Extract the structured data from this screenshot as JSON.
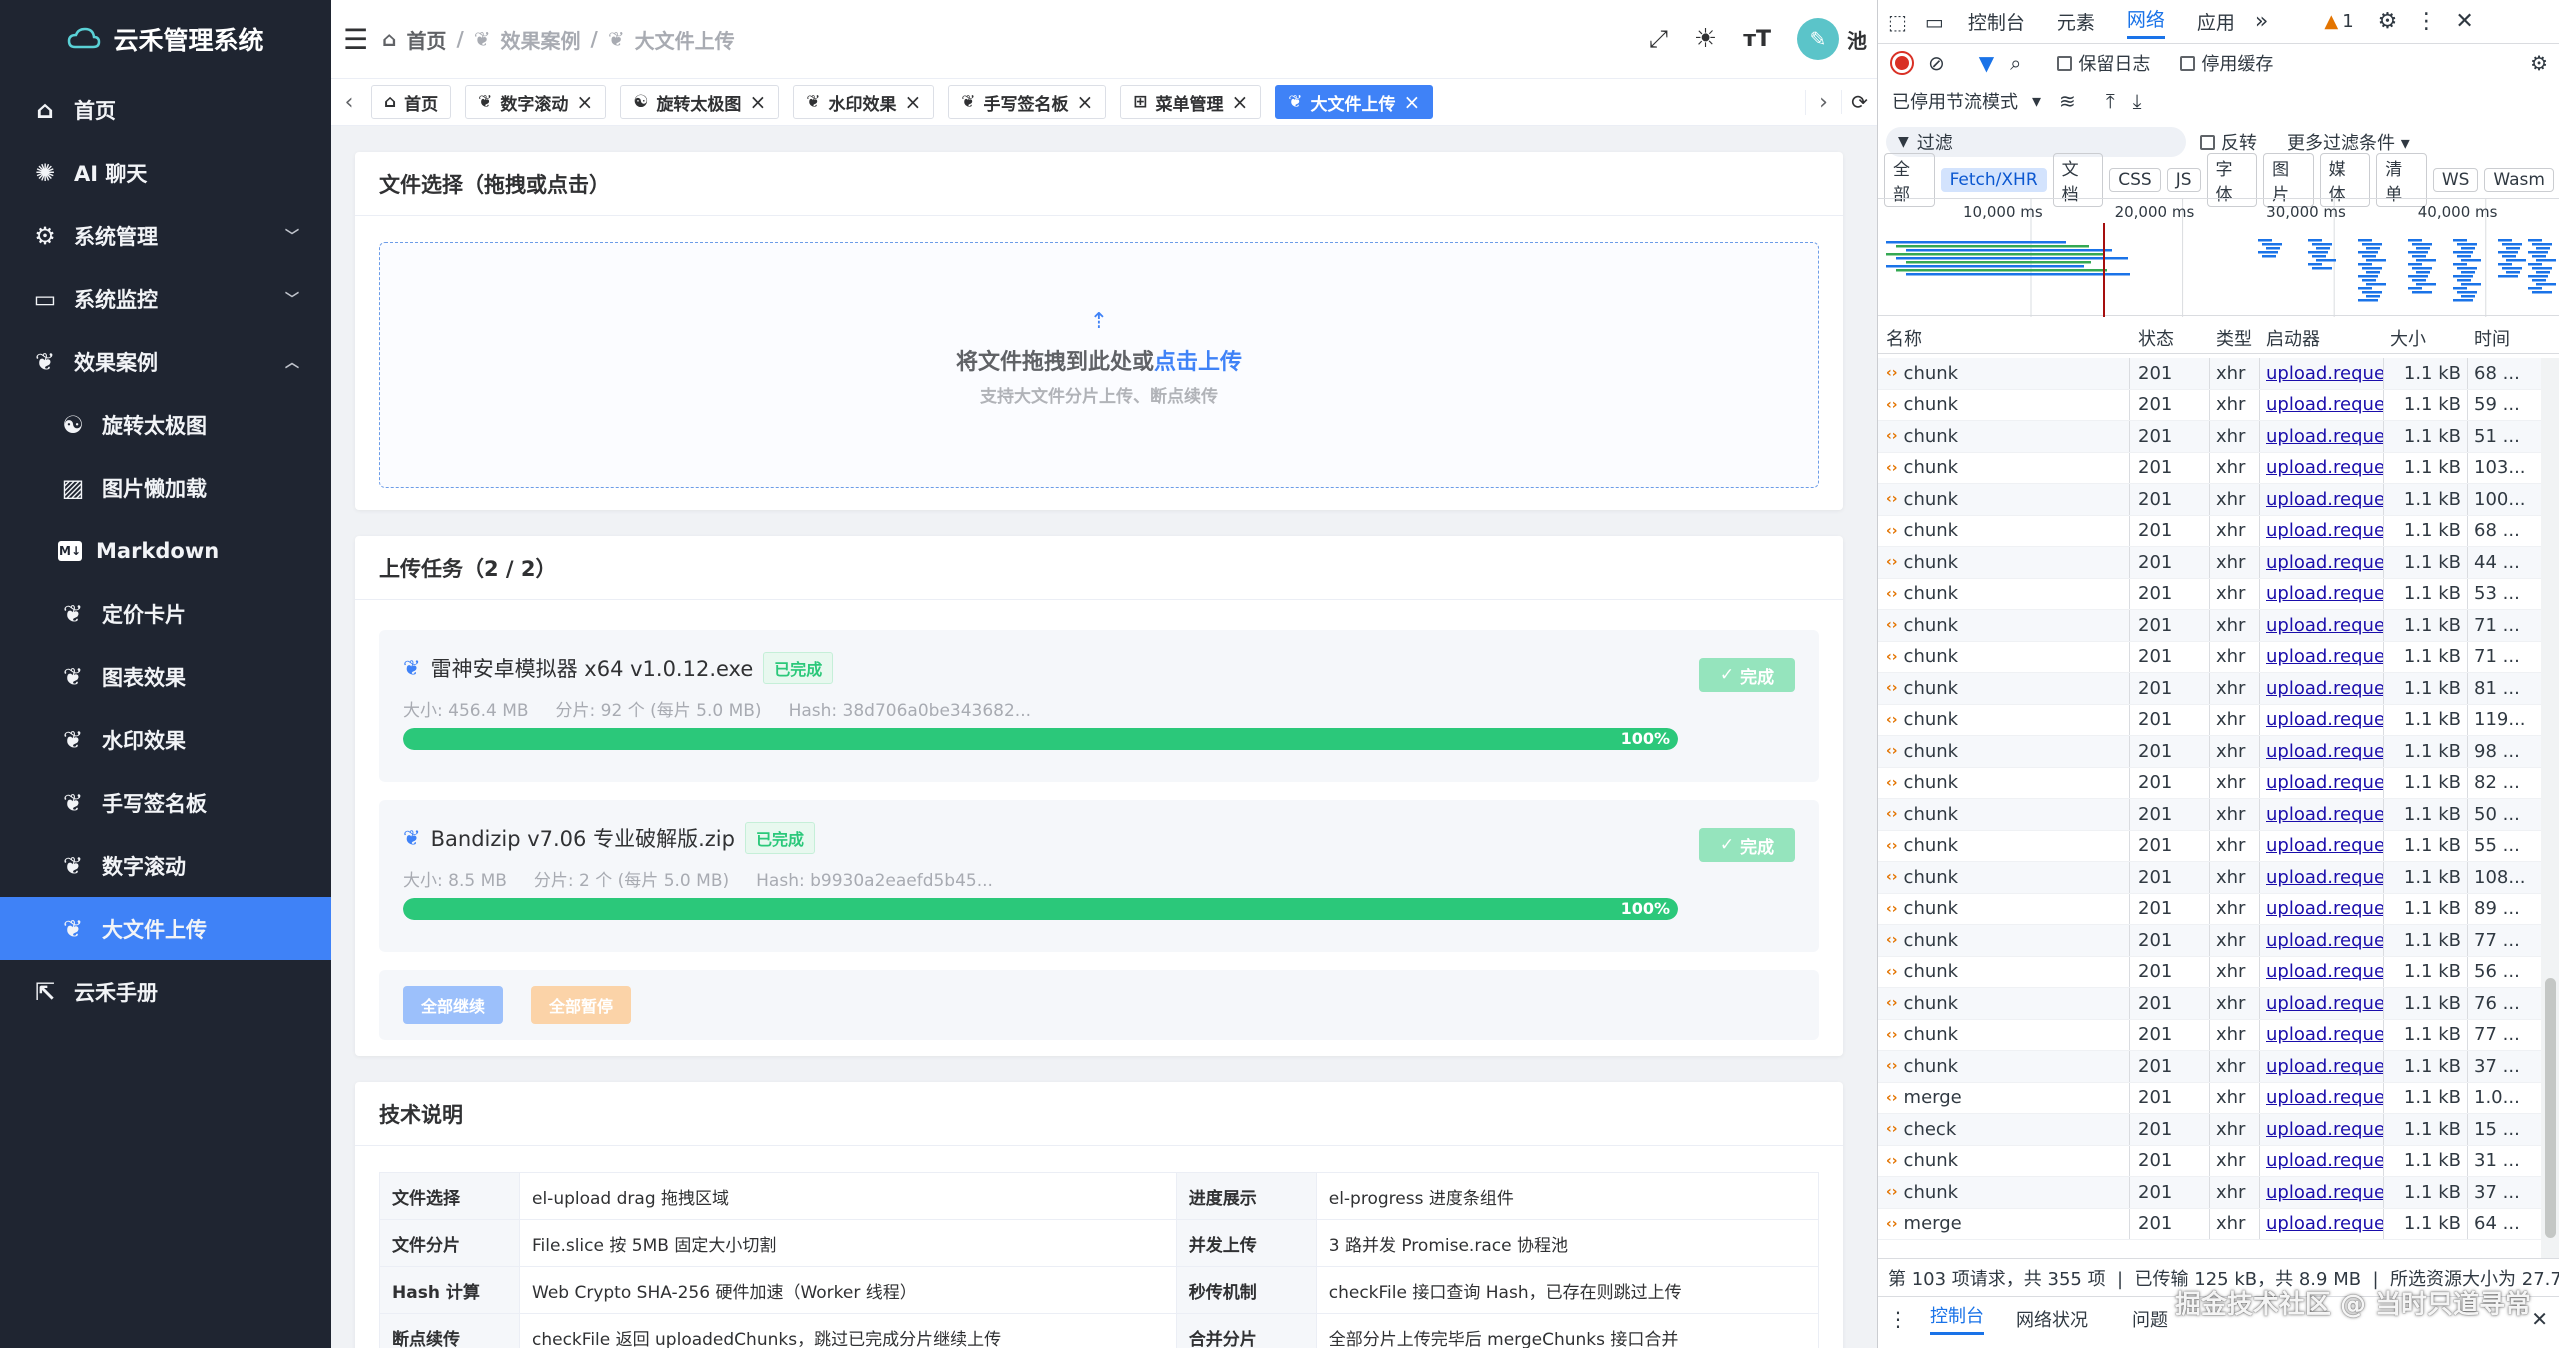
{
  "app": {
    "title": "云禾管理系统"
  },
  "sidebar": {
    "items": [
      {
        "label": "首页",
        "icon": "home-icon",
        "sub": false,
        "arrow": ""
      },
      {
        "label": "AI 聊天",
        "icon": "openai-icon",
        "sub": false,
        "arrow": ""
      },
      {
        "label": "系统管理",
        "icon": "gear-icon",
        "sub": false,
        "arrow": "down"
      },
      {
        "label": "系统监控",
        "icon": "monitor-icon",
        "sub": false,
        "arrow": "down"
      },
      {
        "label": "效果案例",
        "icon": "leaf-icon",
        "sub": false,
        "arrow": "up"
      },
      {
        "label": "旋转太极图",
        "icon": "taiji-icon",
        "sub": true,
        "arrow": ""
      },
      {
        "label": "图片懒加载",
        "icon": "image-icon",
        "sub": true,
        "arrow": ""
      },
      {
        "label": "Markdown",
        "icon": "markdown-icon",
        "sub": true,
        "arrow": ""
      },
      {
        "label": "定价卡片",
        "icon": "leaf-icon",
        "sub": true,
        "arrow": ""
      },
      {
        "label": "图表效果",
        "icon": "leaf-icon",
        "sub": true,
        "arrow": ""
      },
      {
        "label": "水印效果",
        "icon": "leaf-icon",
        "sub": true,
        "arrow": ""
      },
      {
        "label": "手写签名板",
        "icon": "leaf-icon",
        "sub": true,
        "arrow": ""
      },
      {
        "label": "数字滚动",
        "icon": "leaf-icon",
        "sub": true,
        "arrow": ""
      },
      {
        "label": "大文件上传",
        "icon": "leaf-icon",
        "sub": true,
        "arrow": "",
        "active": true
      },
      {
        "label": "云禾手册",
        "icon": "external-link-icon",
        "sub": false,
        "arrow": ""
      }
    ]
  },
  "header": {
    "breadcrumb": [
      "首页",
      "效果案例",
      "大文件上传"
    ],
    "breadcrumb_sep": "/",
    "user_name": "池"
  },
  "tabs": [
    {
      "label": "首页",
      "icon": "home-icon",
      "closable": false
    },
    {
      "label": "数字滚动",
      "icon": "leaf-icon",
      "closable": true
    },
    {
      "label": "旋转太极图",
      "icon": "taiji-icon",
      "closable": true
    },
    {
      "label": "水印效果",
      "icon": "leaf-icon",
      "closable": true
    },
    {
      "label": "手写签名板",
      "icon": "leaf-icon",
      "closable": true
    },
    {
      "label": "菜单管理",
      "icon": "grid-icon",
      "closable": true
    },
    {
      "label": "大文件上传",
      "icon": "leaf-icon",
      "closable": true,
      "active": true
    }
  ],
  "upload_card": {
    "title": "文件选择（拖拽或点击）",
    "drop_text": "将文件拖拽到此处或",
    "drop_link": "点击上传",
    "drop_hint": "支持大文件分片上传、断点续传"
  },
  "tasks_card": {
    "title": "上传任务（2 / 2）",
    "tasks": [
      {
        "name": "雷神安卓模拟器 x64 v1.0.12.exe",
        "status": "已完成",
        "meta": "大小: 456.4 MB     分片: 92 个 (每片 5.0 MB)     Hash: 38d706a0be343682...",
        "progress": 100,
        "progress_label": "100%",
        "button": "完成"
      },
      {
        "name": "Bandizip v7.06 专业破解版.zip",
        "status": "已完成",
        "meta": "大小: 8.5 MB     分片: 2 个 (每片 5.0 MB)     Hash: b9930a2eaefd5b45...",
        "progress": 100,
        "progress_label": "100%",
        "button": "完成"
      }
    ],
    "resume_all": "全部继续",
    "pause_all": "全部暂停"
  },
  "tech_card": {
    "title": "技术说明",
    "rows": [
      {
        "k1": "文件选择",
        "v1": "el-upload drag 拖拽区域",
        "k2": "进度展示",
        "v2": "el-progress 进度条组件"
      },
      {
        "k1": "文件分片",
        "v1": "File.slice 按 5MB 固定大小切割",
        "k2": "并发上传",
        "v2": "3 路并发 Promise.race 协程池"
      },
      {
        "k1": "Hash 计算",
        "v1": "Web Crypto SHA-256 硬件加速（Worker 线程）",
        "k2": "秒传机制",
        "v2": "checkFile 接口查询 Hash，已存在则跳过上传"
      },
      {
        "k1": "断点续传",
        "v1": "checkFile 返回 uploadedChunks，跳过已完成分片继续上传",
        "k2": "合并分片",
        "v2": "全部分片上传完毕后 mergeChunks 接口合并"
      }
    ]
  },
  "devtools": {
    "tabs": [
      "控制台",
      "元素",
      "网络",
      "应用"
    ],
    "active_tab": "网络",
    "warn_count": "1",
    "preserve_log": "保留日志",
    "disable_cache": "停用缓存",
    "throttle": "已停用节流模式",
    "filter_placeholder": "过滤",
    "invert": "反转",
    "more_filters": "更多过滤条件",
    "filter_types": [
      "全部",
      "Fetch/XHR",
      "文档",
      "CSS",
      "JS",
      "字体",
      "图片",
      "媒体",
      "清单",
      "WS",
      "Wasm"
    ],
    "active_filter": "Fetch/XHR",
    "timeline_labels": [
      "10,000 ms",
      "20,000 ms",
      "30,000 ms",
      "40,000 ms"
    ],
    "columns": [
      "名称",
      "状态",
      "类型",
      "启动器",
      "大小",
      "时间"
    ],
    "rows": [
      {
        "name": "chunk",
        "status": "201",
        "type": "xhr",
        "initiator": "upload.reque",
        "size": "1.1 kB",
        "time": "68 ..."
      },
      {
        "name": "chunk",
        "status": "201",
        "type": "xhr",
        "initiator": "upload.reque",
        "size": "1.1 kB",
        "time": "59 ..."
      },
      {
        "name": "chunk",
        "status": "201",
        "type": "xhr",
        "initiator": "upload.reque",
        "size": "1.1 kB",
        "time": "51 ..."
      },
      {
        "name": "chunk",
        "status": "201",
        "type": "xhr",
        "initiator": "upload.reque",
        "size": "1.1 kB",
        "time": "103..."
      },
      {
        "name": "chunk",
        "status": "201",
        "type": "xhr",
        "initiator": "upload.reque",
        "size": "1.1 kB",
        "time": "100..."
      },
      {
        "name": "chunk",
        "status": "201",
        "type": "xhr",
        "initiator": "upload.reque",
        "size": "1.1 kB",
        "time": "68 ..."
      },
      {
        "name": "chunk",
        "status": "201",
        "type": "xhr",
        "initiator": "upload.reque",
        "size": "1.1 kB",
        "time": "44 ..."
      },
      {
        "name": "chunk",
        "status": "201",
        "type": "xhr",
        "initiator": "upload.reque",
        "size": "1.1 kB",
        "time": "53 ..."
      },
      {
        "name": "chunk",
        "status": "201",
        "type": "xhr",
        "initiator": "upload.reque",
        "size": "1.1 kB",
        "time": "71 ..."
      },
      {
        "name": "chunk",
        "status": "201",
        "type": "xhr",
        "initiator": "upload.reque",
        "size": "1.1 kB",
        "time": "71 ..."
      },
      {
        "name": "chunk",
        "status": "201",
        "type": "xhr",
        "initiator": "upload.reque",
        "size": "1.1 kB",
        "time": "81 ..."
      },
      {
        "name": "chunk",
        "status": "201",
        "type": "xhr",
        "initiator": "upload.reque",
        "size": "1.1 kB",
        "time": "119..."
      },
      {
        "name": "chunk",
        "status": "201",
        "type": "xhr",
        "initiator": "upload.reque",
        "size": "1.1 kB",
        "time": "98 ..."
      },
      {
        "name": "chunk",
        "status": "201",
        "type": "xhr",
        "initiator": "upload.reque",
        "size": "1.1 kB",
        "time": "82 ..."
      },
      {
        "name": "chunk",
        "status": "201",
        "type": "xhr",
        "initiator": "upload.reque",
        "size": "1.1 kB",
        "time": "50 ..."
      },
      {
        "name": "chunk",
        "status": "201",
        "type": "xhr",
        "initiator": "upload.reque",
        "size": "1.1 kB",
        "time": "55 ..."
      },
      {
        "name": "chunk",
        "status": "201",
        "type": "xhr",
        "initiator": "upload.reque",
        "size": "1.1 kB",
        "time": "108..."
      },
      {
        "name": "chunk",
        "status": "201",
        "type": "xhr",
        "initiator": "upload.reque",
        "size": "1.1 kB",
        "time": "89 ..."
      },
      {
        "name": "chunk",
        "status": "201",
        "type": "xhr",
        "initiator": "upload.reque",
        "size": "1.1 kB",
        "time": "77 ..."
      },
      {
        "name": "chunk",
        "status": "201",
        "type": "xhr",
        "initiator": "upload.reque",
        "size": "1.1 kB",
        "time": "56 ..."
      },
      {
        "name": "chunk",
        "status": "201",
        "type": "xhr",
        "initiator": "upload.reque",
        "size": "1.1 kB",
        "time": "76 ..."
      },
      {
        "name": "chunk",
        "status": "201",
        "type": "xhr",
        "initiator": "upload.reque",
        "size": "1.1 kB",
        "time": "77 ..."
      },
      {
        "name": "chunk",
        "status": "201",
        "type": "xhr",
        "initiator": "upload.reque",
        "size": "1.1 kB",
        "time": "37 ..."
      },
      {
        "name": "merge",
        "status": "201",
        "type": "xhr",
        "initiator": "upload.reque",
        "size": "1.1 kB",
        "time": "1.0..."
      },
      {
        "name": "check",
        "status": "201",
        "type": "xhr",
        "initiator": "upload.reque",
        "size": "1.1 kB",
        "time": "15 ..."
      },
      {
        "name": "chunk",
        "status": "201",
        "type": "xhr",
        "initiator": "upload.reque",
        "size": "1.1 kB",
        "time": "31 ..."
      },
      {
        "name": "chunk",
        "status": "201",
        "type": "xhr",
        "initiator": "upload.reque",
        "size": "1.1 kB",
        "time": "37 ..."
      },
      {
        "name": "merge",
        "status": "201",
        "type": "xhr",
        "initiator": "upload.reque",
        "size": "1.1 kB",
        "time": "64 ..."
      }
    ],
    "summary": "第 103 项请求，共 355 项  |  已传输 125 kB，共 8.9 MB  |  所选资源大小为 27.7",
    "drawer_tabs": [
      "控制台",
      "网络状况",
      "问题"
    ],
    "watermark": "掘金技术社区 @ 当时只道寻常"
  },
  "colors": {
    "sidebar_bg": "#1f2531",
    "accent": "#3f82f7",
    "success": "#2bc87a"
  }
}
